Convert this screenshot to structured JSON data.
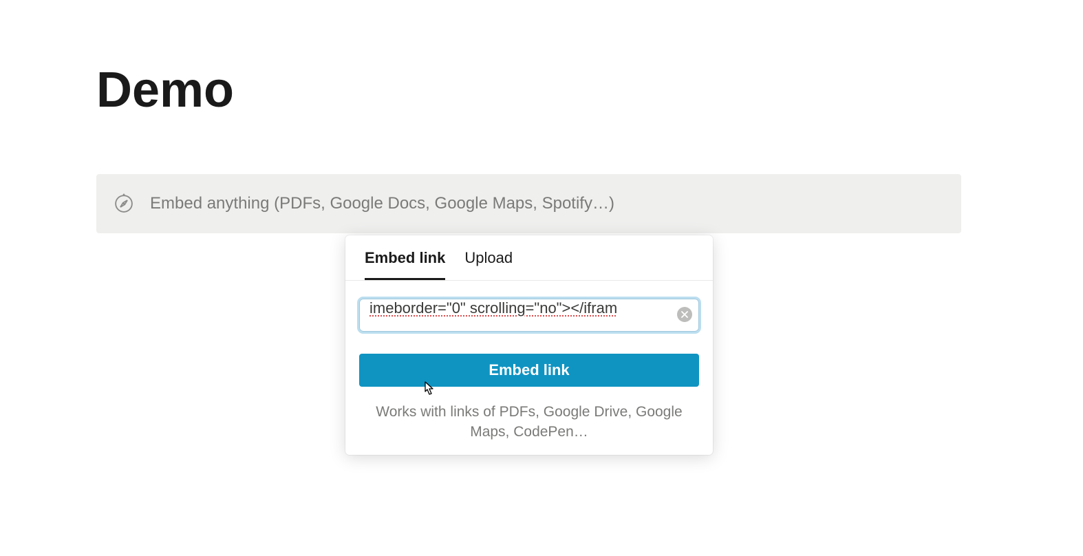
{
  "page": {
    "title": "Demo"
  },
  "embed_block": {
    "placeholder": "Embed anything (PDFs, Google Docs, Google Maps, Spotify…)"
  },
  "popover": {
    "tabs": {
      "embed_link": "Embed link",
      "upload": "Upload"
    },
    "input_value": "imeborder=\"0\" scrolling=\"no\"></ifram",
    "button_label": "Embed link",
    "help_text": "Works with links of PDFs, Google Drive, Google Maps, CodePen…"
  }
}
